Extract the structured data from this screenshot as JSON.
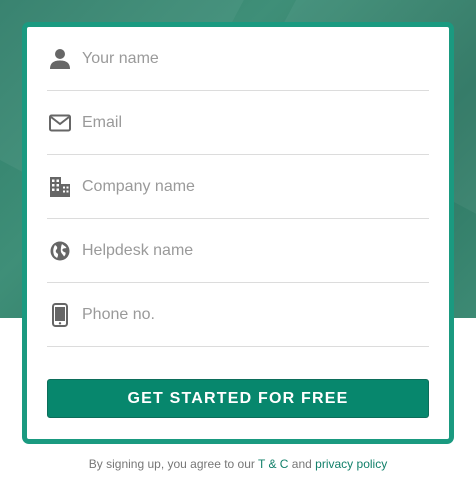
{
  "form": {
    "fields": [
      {
        "name": "your-name",
        "icon": "user-icon",
        "placeholder": "Your name",
        "value": ""
      },
      {
        "name": "email",
        "icon": "envelope-icon",
        "placeholder": "Email",
        "value": ""
      },
      {
        "name": "company-name",
        "icon": "building-icon",
        "placeholder": "Company name",
        "value": ""
      },
      {
        "name": "helpdesk-name",
        "icon": "globe-icon",
        "placeholder": "Helpdesk name",
        "value": ""
      },
      {
        "name": "phone",
        "icon": "mobile-phone-icon",
        "placeholder": "Phone no.",
        "value": ""
      }
    ],
    "submit_label": "GET STARTED FOR FREE"
  },
  "terms": {
    "prefix": "By signing up, you agree to our ",
    "tc_link": "T & C",
    "conjunction": " and ",
    "privacy_link": "privacy policy"
  },
  "colors": {
    "accent": "#1a9a80",
    "button": "#07876d",
    "background_top": "#3a8a74",
    "link": "#12806a"
  }
}
